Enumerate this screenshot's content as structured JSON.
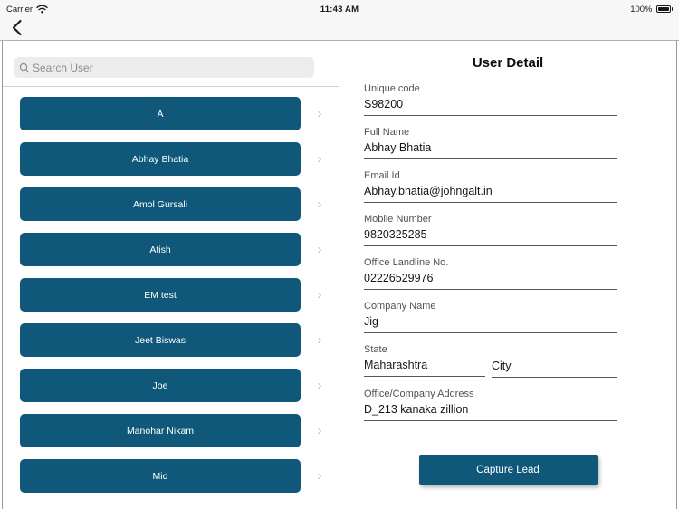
{
  "status_bar": {
    "carrier": "Carrier",
    "time": "11:43 AM",
    "battery_percent": "100%"
  },
  "search": {
    "placeholder": "Search User"
  },
  "icons": {
    "row_chevron": "›"
  },
  "user_list": [
    "A",
    "Abhay Bhatia",
    "Amol Gursali",
    "Atish",
    "EM test",
    "Jeet Biswas",
    "Joe",
    "Manohar Nikam",
    "Mid"
  ],
  "detail": {
    "title": "User Detail",
    "fields": [
      {
        "label": "Unique code",
        "value": "S98200"
      },
      {
        "label": "Full Name",
        "value": "Abhay Bhatia"
      },
      {
        "label": "Email Id",
        "value": "Abhay.bhatia@johngalt.in"
      },
      {
        "label": "Mobile Number",
        "value": "9820325285"
      },
      {
        "label": "Office Landline No.",
        "value": "02226529976"
      },
      {
        "label": "Company Name",
        "value": "Jig"
      }
    ],
    "state_field": {
      "label": "State",
      "value": "Maharashtra"
    },
    "city_field": {
      "placeholder": "City"
    },
    "address_field": {
      "label": "Office/Company Address",
      "value": "D_213 kanaka zillion"
    },
    "capture_button_label": "Capture Lead"
  },
  "colors": {
    "accent_teal": "#10587a",
    "chrome_bg": "#f7f7f8",
    "underline": "#55555a"
  }
}
